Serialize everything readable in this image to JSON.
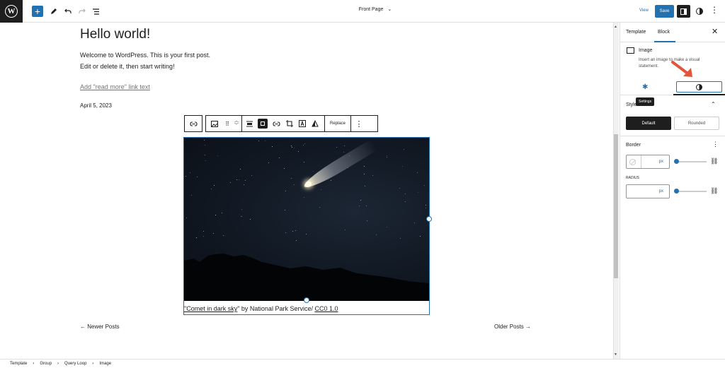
{
  "topbar": {
    "add_label": "+",
    "document_title": "Front Page",
    "view_label": "View",
    "save_label": "Save"
  },
  "post": {
    "title": "Hello world!",
    "paragraph_line1": "Welcome to WordPress. This is your first post.",
    "paragraph_line2": "Edit or delete it, then start writing!",
    "read_more": "Add \"read more\" link text",
    "date": "April 5, 2023"
  },
  "block_toolbar": {
    "replace_label": "Replace"
  },
  "image_block": {
    "caption_link": "\"Comet in dark sky",
    "caption_middle": "\" by National Park Service/ ",
    "caption_license": "CC0 1.0"
  },
  "navigation": {
    "newer": "← Newer Posts",
    "older": "Older Posts →"
  },
  "sidebar": {
    "tab_template": "Template",
    "tab_block": "Block",
    "block_name": "Image",
    "block_description": "Insert an image to make a visual statement.",
    "tooltip": "Settings",
    "styles_title": "Styles",
    "style_default": "Default",
    "style_rounded": "Rounded",
    "border_title": "Border",
    "border_unit": "px",
    "radius_label": "RADIUS",
    "radius_unit": "px"
  },
  "breadcrumb": {
    "items": [
      "Template",
      "Group",
      "Query Loop",
      "Image"
    ]
  },
  "colors": {
    "accent": "#2271b1",
    "dark": "#1e1e1e",
    "annotation_arrow": "#e2553d"
  }
}
